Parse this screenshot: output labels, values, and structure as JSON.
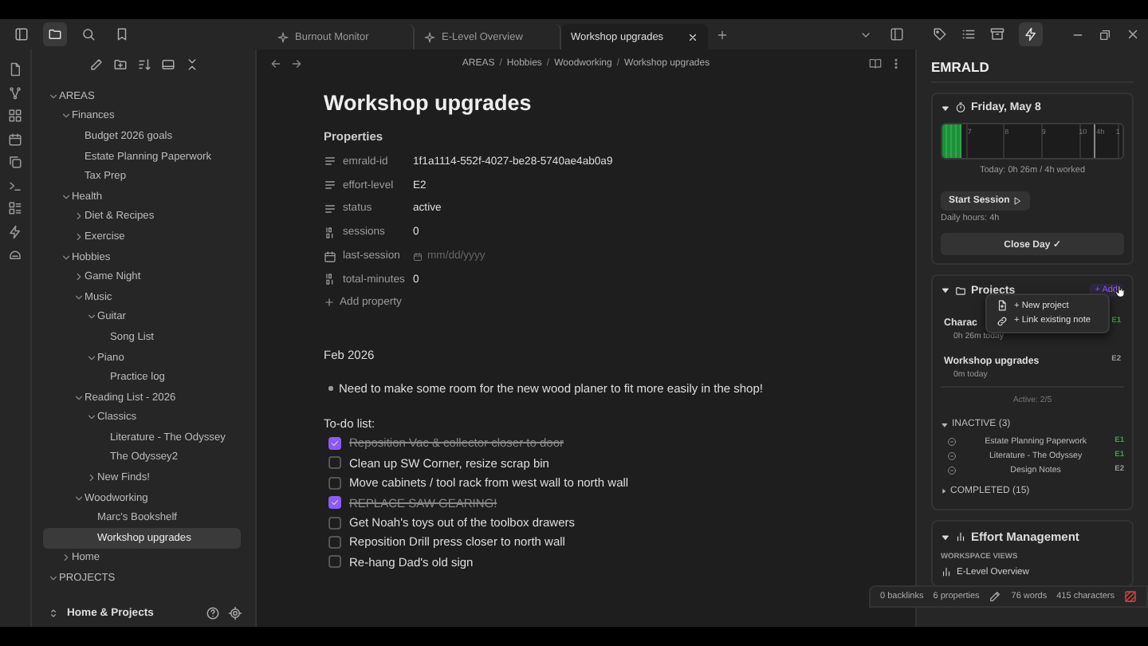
{
  "tabs": [
    {
      "label": "Burnout Monitor",
      "kind": "view",
      "selected": false
    },
    {
      "label": "E-Level Overview",
      "kind": "view",
      "selected": false
    },
    {
      "label": "Workshop upgrades",
      "kind": "note",
      "selected": true
    }
  ],
  "explorer": {
    "tree": [
      {
        "label": "AREAS",
        "selected": false,
        "expanded": true,
        "children": [
          {
            "label": "Finances",
            "selected": false,
            "expanded": true,
            "children": [
              {
                "label": "Budget 2026 goals",
                "selected": false
              },
              {
                "label": "Estate Planning Paperwork",
                "selected": false
              },
              {
                "label": "Tax Prep",
                "selected": false
              }
            ]
          },
          {
            "label": "Health",
            "selected": false,
            "expanded": true,
            "children": [
              {
                "label": "Diet & Recipes",
                "selected": false,
                "expanded": false
              },
              {
                "label": "Exercise",
                "selected": false,
                "expanded": false
              }
            ]
          },
          {
            "label": "Hobbies",
            "selected": false,
            "expanded": true,
            "children": [
              {
                "label": "Game Night",
                "selected": false,
                "expanded": false
              },
              {
                "label": "Music",
                "selected": false,
                "expanded": true,
                "children": [
                  {
                    "label": "Guitar",
                    "selected": false,
                    "expanded": true,
                    "children": [
                      {
                        "label": "Song List",
                        "selected": false
                      }
                    ]
                  },
                  {
                    "label": "Piano",
                    "selected": false,
                    "expanded": true,
                    "children": [
                      {
                        "label": "Practice log",
                        "selected": false
                      }
                    ]
                  }
                ]
              },
              {
                "label": "Reading List - 2026",
                "selected": false,
                "expanded": true,
                "children": [
                  {
                    "label": "Classics",
                    "selected": false,
                    "expanded": true,
                    "children": [
                      {
                        "label": "Literature - The Odyssey",
                        "selected": false
                      },
                      {
                        "label": "The Odyssey2",
                        "selected": false
                      }
                    ]
                  },
                  {
                    "label": "New Finds!",
                    "selected": false,
                    "expanded": false
                  }
                ]
              },
              {
                "label": "Woodworking",
                "selected": false,
                "expanded": true,
                "children": [
                  {
                    "label": "Marc's Bookshelf",
                    "selected": false
                  },
                  {
                    "label": "Workshop upgrades",
                    "selected": true
                  }
                ]
              }
            ]
          },
          {
            "label": "Home",
            "selected": false,
            "expanded": false
          }
        ]
      },
      {
        "label": "PROJECTS",
        "selected": false,
        "expanded": true
      }
    ],
    "vault_name": "Home & Projects"
  },
  "breadcrumb": [
    "AREAS",
    "Hobbies",
    "Woodworking",
    "Workshop upgrades"
  ],
  "breadcrumb_separator": "/",
  "note": {
    "title": "Workshop upgrades",
    "properties_heading": "Properties",
    "properties": [
      {
        "kind": "text",
        "key": "emrald-id",
        "value": "1f1a1114-552f-4027-be28-5740ae4ab0a9"
      },
      {
        "kind": "text",
        "key": "effort-level",
        "value": "E2"
      },
      {
        "kind": "text",
        "key": "status",
        "value": "active"
      },
      {
        "kind": "number",
        "key": "sessions",
        "value": "0"
      },
      {
        "kind": "date",
        "key": "last-session",
        "placeholder": "mm/dd/yyyy"
      },
      {
        "kind": "number",
        "key": "total-minutes",
        "value": "0"
      }
    ],
    "add_property": "Add property",
    "date_heading": "Feb 2026",
    "bullets": [
      "Need to make some room for the new wood planer to fit more easily in the shop!"
    ],
    "todo_heading": "To-do list:",
    "todos": [
      {
        "text": "Reposition Vac & collector closer to door",
        "checked": true
      },
      {
        "text": "Clean up SW Corner, resize scrap bin",
        "checked": false
      },
      {
        "text": "Move cabinets / tool rack from west wall to north wall",
        "checked": false
      },
      {
        "text": "REPLACE SAW GEARING!",
        "checked": true
      },
      {
        "text": "Get Noah's toys out of the toolbox drawers",
        "checked": false
      },
      {
        "text": "Reposition Drill press closer to north wall",
        "checked": false
      },
      {
        "text": "Re-hang Dad's old sign",
        "checked": false
      }
    ]
  },
  "panel": {
    "title": "EMRALD",
    "day": {
      "title": "Friday, May 8",
      "expanded": true,
      "hours": [
        "7",
        "8",
        "9",
        "10",
        "1"
      ],
      "target_label": "4h",
      "level": 0.11,
      "summary": "Today: 0h 26m / 4h worked",
      "start_button": "Start Session",
      "daily_hours": "Daily hours: 4h",
      "close_button": "Close Day ✓"
    },
    "projects": {
      "title": "Projects",
      "expanded": true,
      "add_button": "+ Add",
      "menu": [
        {
          "kind": "new",
          "label": "+ New project"
        },
        {
          "kind": "link",
          "label": "+ Link existing note"
        }
      ],
      "items": [
        {
          "name": "Charac",
          "detail": "0h 26m today",
          "badge": "E1",
          "color": "#3fa34d"
        },
        {
          "name": "Workshop upgrades",
          "detail": "0m today",
          "badge": "E2",
          "color": "#9a9a9a"
        }
      ],
      "active_count": "Active: 2/5",
      "inactive": {
        "title": "INACTIVE (3)",
        "expanded": true,
        "items": [
          {
            "name": "Estate Planning Paperwork",
            "badge": "E1",
            "color": "#3fa34d"
          },
          {
            "name": "Literature - The Odyssey",
            "badge": "E1",
            "color": "#3fa34d"
          },
          {
            "name": "Design Notes",
            "badge": "E2",
            "color": "#9a9a9a"
          }
        ]
      },
      "completed": {
        "title": "COMPLETED (15)",
        "expanded": false
      }
    },
    "effort": {
      "title": "Effort Management",
      "expanded": true,
      "section": "WORKSPACE VIEWS",
      "items": [
        "E-Level Overview"
      ]
    }
  },
  "status_bar": {
    "backlinks": "0 backlinks",
    "properties": "6 properties",
    "words": "76 words",
    "characters": "415 characters"
  }
}
